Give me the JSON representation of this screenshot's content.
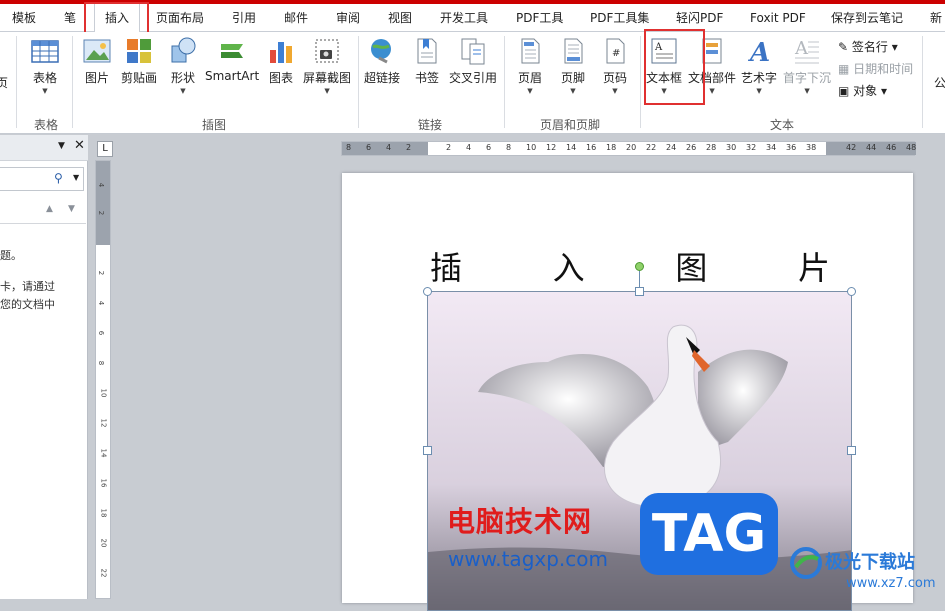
{
  "tabs": [
    "模板",
    "笔",
    "插入",
    "页面布局",
    "引用",
    "邮件",
    "审阅",
    "视图",
    "开发工具",
    "PDF工具",
    "PDF工具集",
    "轻闪PDF",
    "Foxit PDF",
    "保存到云笔记",
    "新"
  ],
  "ribbon": {
    "left_cut": "页",
    "table": {
      "label": "表格",
      "group": "表格"
    },
    "illus": {
      "items": [
        "图片",
        "剪贴画",
        "形状",
        "SmartArt",
        "图表",
        "屏幕截图"
      ],
      "group": "插图"
    },
    "links": {
      "items": [
        "超链接",
        "书签",
        "交叉引用"
      ],
      "group": "链接"
    },
    "hf": {
      "items": [
        "页眉",
        "页脚",
        "页码"
      ],
      "group": "页眉和页脚"
    },
    "text": {
      "items": [
        "文本框",
        "文档部件",
        "艺术字",
        "首字下沉"
      ],
      "group": "文本",
      "side": [
        "签名行",
        "日期和时间",
        "对象"
      ]
    },
    "right_cut": "公"
  },
  "leftpane": {
    "lines": [
      "题。",
      "卡，请通过",
      "您的文档中"
    ]
  },
  "ruler": {
    "box": "L",
    "h_numbers": [
      "8",
      "6",
      "4",
      "2",
      "2",
      "4",
      "6",
      "8",
      "10",
      "12",
      "14",
      "16",
      "18",
      "20",
      "22",
      "24",
      "26",
      "28",
      "30",
      "32",
      "34",
      "36",
      "38",
      "42",
      "44",
      "46",
      "48"
    ],
    "v_numbers": [
      "4",
      "2",
      "2",
      "4",
      "6",
      "8",
      "10",
      "12",
      "14",
      "16",
      "18",
      "20",
      "22"
    ]
  },
  "doc": {
    "heading": [
      "插",
      "入",
      "图",
      "片"
    ]
  },
  "watermark": {
    "site_name": "电脑技术网",
    "site_url": "www.tagxp.com",
    "tag": "TAG",
    "brand": "极光下载站",
    "brand_url": "www.xz7.com"
  },
  "colors": {
    "highlight": "#e03030",
    "accent": "#c00000"
  }
}
